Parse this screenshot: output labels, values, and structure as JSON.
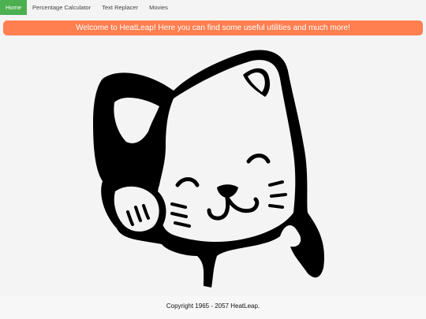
{
  "nav": {
    "items": [
      {
        "label": "Home",
        "active": true
      },
      {
        "label": "Percentage Calculator",
        "active": false
      },
      {
        "label": "Text Replacer",
        "active": false
      },
      {
        "label": "Movies",
        "active": false
      }
    ]
  },
  "banner": {
    "text": "Welcome to HeatLeap! Here you can find some useful utilities and much more!",
    "color": "#ff7f50"
  },
  "illustration": {
    "icon": "waving-cat-icon"
  },
  "footer": {
    "copyright": "Copyright 1965 - 2057 HeatLeap."
  },
  "colors": {
    "nav_active": "#4caf50",
    "background": "#f4f4f4"
  }
}
